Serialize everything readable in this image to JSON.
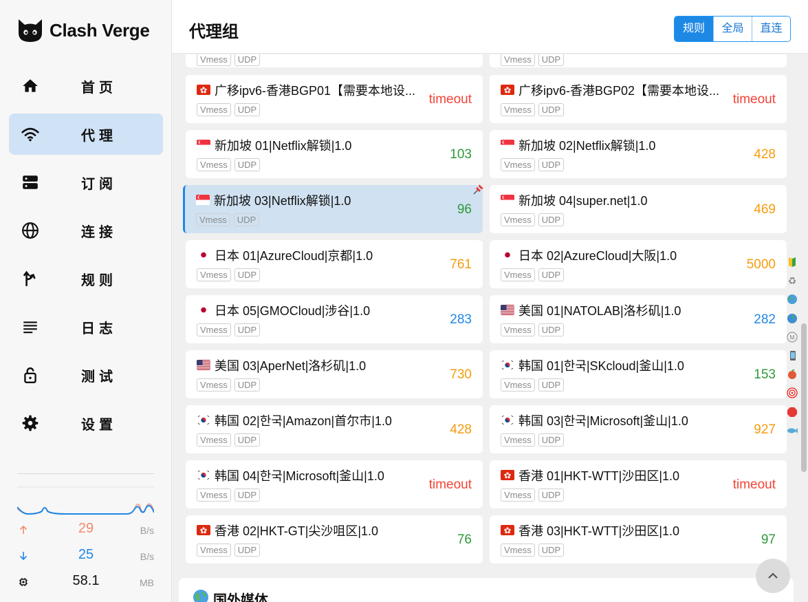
{
  "app": {
    "name": "Clash Verge"
  },
  "nav": [
    {
      "id": "home",
      "label": "首页",
      "active": false
    },
    {
      "id": "proxy",
      "label": "代理",
      "active": true
    },
    {
      "id": "subscribe",
      "label": "订阅",
      "active": false
    },
    {
      "id": "connections",
      "label": "连接",
      "active": false
    },
    {
      "id": "rules",
      "label": "规则",
      "active": false
    },
    {
      "id": "logs",
      "label": "日志",
      "active": false
    },
    {
      "id": "test",
      "label": "测试",
      "active": false
    },
    {
      "id": "settings",
      "label": "设置",
      "active": false
    }
  ],
  "traffic": {
    "upload": {
      "value": "29",
      "unit": "B/s",
      "color": "#f28b6b"
    },
    "download": {
      "value": "25",
      "unit": "B/s",
      "color": "#1e88e5"
    },
    "memory": {
      "value": "58.1",
      "unit": "MB"
    }
  },
  "header": {
    "title": "代理组",
    "modes": [
      {
        "label": "规则",
        "active": true
      },
      {
        "label": "全局",
        "active": false
      },
      {
        "label": "直连",
        "active": false
      }
    ]
  },
  "proxies": [
    {
      "name": "",
      "flag": "",
      "tags": [
        "Vmess",
        "UDP"
      ],
      "delay": "",
      "delay_class": "",
      "partial": true,
      "selected": false
    },
    {
      "name": "",
      "flag": "",
      "tags": [
        "Vmess",
        "UDP"
      ],
      "delay": "",
      "delay_class": "",
      "partial": true,
      "selected": false
    },
    {
      "name": "广移ipv6-香港BGP01【需要本地设...",
      "flag": "hk",
      "tags": [
        "Vmess",
        "UDP"
      ],
      "delay": "timeout",
      "delay_class": "bad",
      "selected": false
    },
    {
      "name": "广移ipv6-香港BGP02【需要本地设...",
      "flag": "hk",
      "tags": [
        "Vmess",
        "UDP"
      ],
      "delay": "timeout",
      "delay_class": "bad",
      "selected": false
    },
    {
      "name": "新加坡 01|Netflix解锁|1.0",
      "flag": "sg",
      "tags": [
        "Vmess",
        "UDP"
      ],
      "delay": "103",
      "delay_class": "good",
      "selected": false
    },
    {
      "name": "新加坡 02|Netflix解锁|1.0",
      "flag": "sg",
      "tags": [
        "Vmess",
        "UDP"
      ],
      "delay": "428",
      "delay_class": "mid",
      "selected": false
    },
    {
      "name": "新加坡 03|Netflix解锁|1.0",
      "flag": "sg",
      "tags": [
        "Vmess",
        "UDP"
      ],
      "delay": "96",
      "delay_class": "good",
      "selected": true
    },
    {
      "name": "新加坡 04|super.net|1.0",
      "flag": "sg",
      "tags": [
        "Vmess",
        "UDP"
      ],
      "delay": "469",
      "delay_class": "mid",
      "selected": false
    },
    {
      "name": "日本 01|AzureCloud|京都|1.0",
      "flag": "jp",
      "tags": [
        "Vmess",
        "UDP"
      ],
      "delay": "761",
      "delay_class": "mid",
      "selected": false
    },
    {
      "name": "日本 02|AzureCloud|大阪|1.0",
      "flag": "jp",
      "tags": [
        "Vmess",
        "UDP"
      ],
      "delay": "5000",
      "delay_class": "mid",
      "selected": false
    },
    {
      "name": "日本 05|GMOCloud|涉谷|1.0",
      "flag": "jp",
      "tags": [
        "Vmess",
        "UDP"
      ],
      "delay": "283",
      "delay_class": "slow",
      "selected": false
    },
    {
      "name": "美国 01|NATOLAB|洛杉矶|1.0",
      "flag": "us",
      "tags": [
        "Vmess",
        "UDP"
      ],
      "delay": "282",
      "delay_class": "slow",
      "selected": false
    },
    {
      "name": "美国 03|AperNet|洛杉矶|1.0",
      "flag": "us",
      "tags": [
        "Vmess",
        "UDP"
      ],
      "delay": "730",
      "delay_class": "mid",
      "selected": false
    },
    {
      "name": "韩国 01|한국|SKcloud|釜山|1.0",
      "flag": "kr",
      "tags": [
        "Vmess",
        "UDP"
      ],
      "delay": "153",
      "delay_class": "good",
      "selected": false
    },
    {
      "name": "韩国 02|한국|Amazon|首尔市|1.0",
      "flag": "kr",
      "tags": [
        "Vmess",
        "UDP"
      ],
      "delay": "428",
      "delay_class": "mid",
      "selected": false
    },
    {
      "name": "韩国 03|한국|Microsoft|釜山|1.0",
      "flag": "kr",
      "tags": [
        "Vmess",
        "UDP"
      ],
      "delay": "927",
      "delay_class": "mid",
      "selected": false
    },
    {
      "name": "韩国 04|한국|Microsoft|釜山|1.0",
      "flag": "kr",
      "tags": [
        "Vmess",
        "UDP"
      ],
      "delay": "timeout",
      "delay_class": "bad",
      "selected": false
    },
    {
      "name": "香港 01|HKT-WTT|沙田区|1.0",
      "flag": "hk",
      "tags": [
        "Vmess",
        "UDP"
      ],
      "delay": "timeout",
      "delay_class": "bad",
      "selected": false
    },
    {
      "name": "香港 02|HKT-GT|尖沙咀区|1.0",
      "flag": "hk",
      "tags": [
        "Vmess",
        "UDP"
      ],
      "delay": "76",
      "delay_class": "good",
      "selected": false
    },
    {
      "name": "香港 03|HKT-WTT|沙田区|1.0",
      "flag": "hk",
      "tags": [
        "Vmess",
        "UDP"
      ],
      "delay": "97",
      "delay_class": "good",
      "selected": false
    }
  ],
  "next_group": {
    "name": "国外媒体",
    "icon": "globe-icon"
  },
  "side_icons": [
    "beginner-icon",
    "recycle-icon",
    "globe-icon",
    "globe-icon",
    "m-icon",
    "phone-icon",
    "apple-icon",
    "target-icon",
    "stop-icon",
    "fish-icon"
  ],
  "colors": {
    "accent": "#1e88e5",
    "good": "#2e9a3a",
    "mid": "#f59c0b",
    "bad": "#f44336",
    "selected_bg": "#d0e1f1"
  }
}
